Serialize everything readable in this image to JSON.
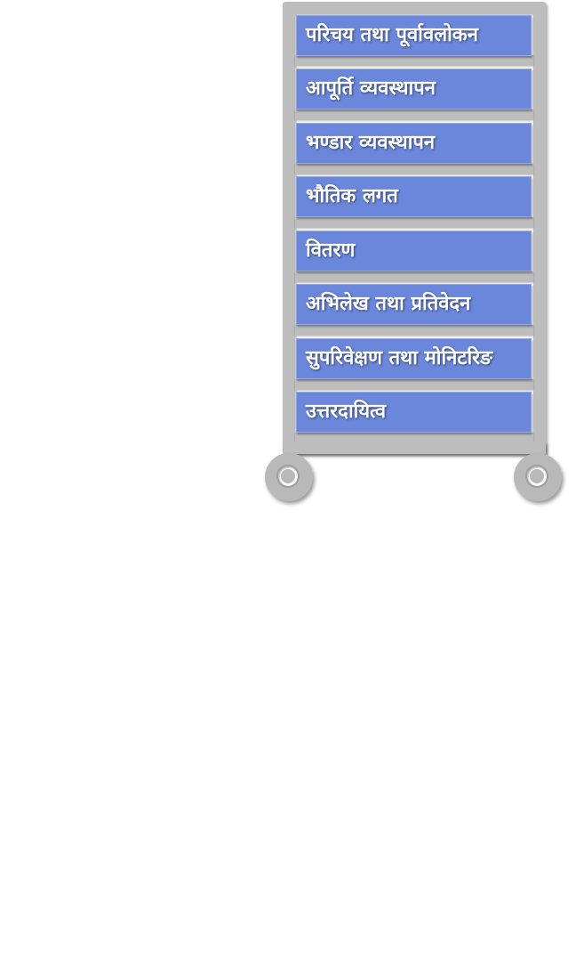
{
  "menu": {
    "items": [
      {
        "label": "परिचय तथा पूर्वावलोकन"
      },
      {
        "label": "आपूर्ति  व्यवस्थापन"
      },
      {
        "label": "भण्डार व्यवस्थापन"
      },
      {
        "label": "भौतिक लगत"
      },
      {
        "label": "वितरण"
      },
      {
        "label": "अभिलेख तथा प्रतिवेदन"
      },
      {
        "label": "सुपरिवेक्षण तथा मोनिटरिङ"
      },
      {
        "label": "उत्तरदायित्व"
      }
    ]
  },
  "colors": {
    "item_fill": "#6a87dc",
    "frame": "#bdbdbd",
    "text": "#ffffff"
  }
}
